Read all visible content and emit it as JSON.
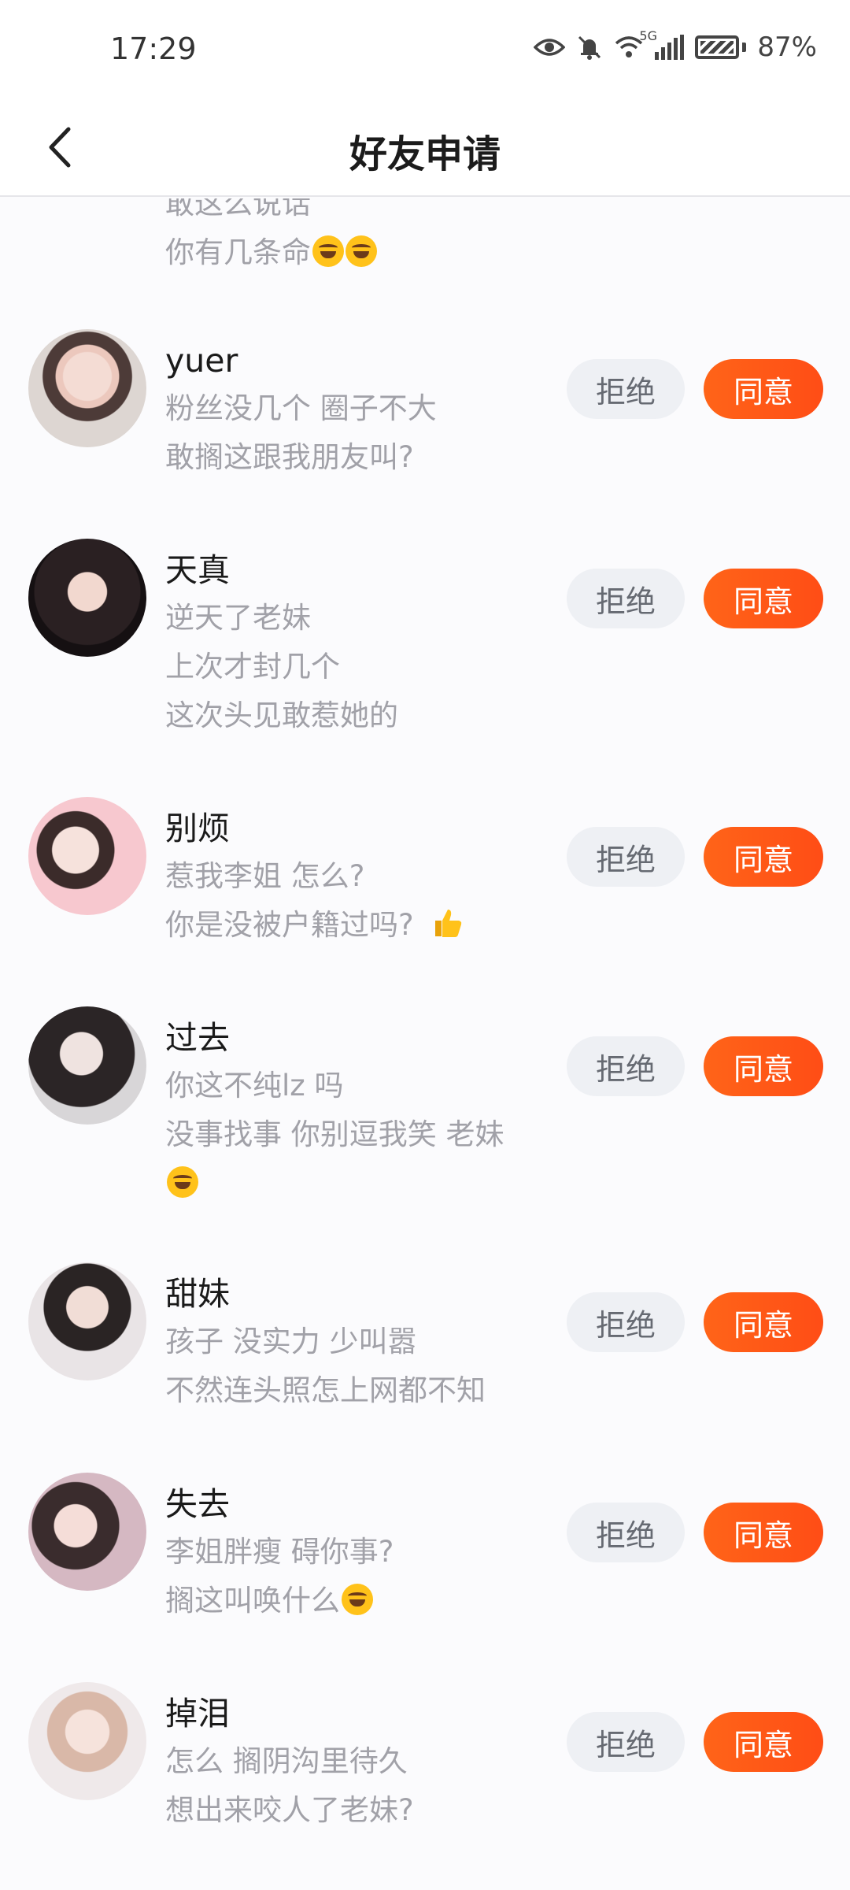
{
  "status_bar": {
    "time": "17:29",
    "network": "5G",
    "battery_percent": "87%",
    "battery_level": 0.87,
    "icons": [
      "eye-icon",
      "bell-muted-icon",
      "wifi-icon",
      "signal-icon",
      "battery-icon"
    ]
  },
  "header": {
    "title": "好友申请",
    "back_icon": "chevron-left-icon"
  },
  "partial_item": {
    "lines": [
      "敢这么说话",
      "你有几条命"
    ],
    "emoji_count": 2
  },
  "requests": [
    {
      "name": "yuer",
      "lines": [
        "粉丝没几个 圈子不大",
        "敢搁这跟我朋友叫?"
      ],
      "reject": "拒绝",
      "accept": "同意"
    },
    {
      "name": "天真",
      "lines": [
        "逆天了老妹",
        "上次才封几个",
        "这次头见敢惹她的"
      ],
      "reject": "拒绝",
      "accept": "同意"
    },
    {
      "name": "别烦",
      "lines": [
        "惹我李姐 怎么?",
        "你是没被户籍过吗? "
      ],
      "reject": "拒绝",
      "accept": "同意"
    },
    {
      "name": "过去",
      "lines": [
        "你这不纯lz 吗",
        "没事找事 你别逗我笑 老妹",
        ""
      ],
      "reject": "拒绝",
      "accept": "同意"
    },
    {
      "name": "甜妹",
      "lines": [
        "孩子 没实力 少叫嚣",
        "不然连头照怎上网都不知"
      ],
      "reject": "拒绝",
      "accept": "同意"
    },
    {
      "name": "失去",
      "lines": [
        "李姐胖瘦 碍你事?",
        "搁这叫唤什么"
      ],
      "reject": "拒绝",
      "accept": "同意"
    },
    {
      "name": "掉泪",
      "lines": [
        "怎么 搁阴沟里待久",
        "想出来咬人了老妹?"
      ],
      "reject": "拒绝",
      "accept": "同意"
    }
  ],
  "colors": {
    "accent": "#ff5a17",
    "reject_bg": "#eef0f4",
    "subtext": "#a1a1a8"
  }
}
